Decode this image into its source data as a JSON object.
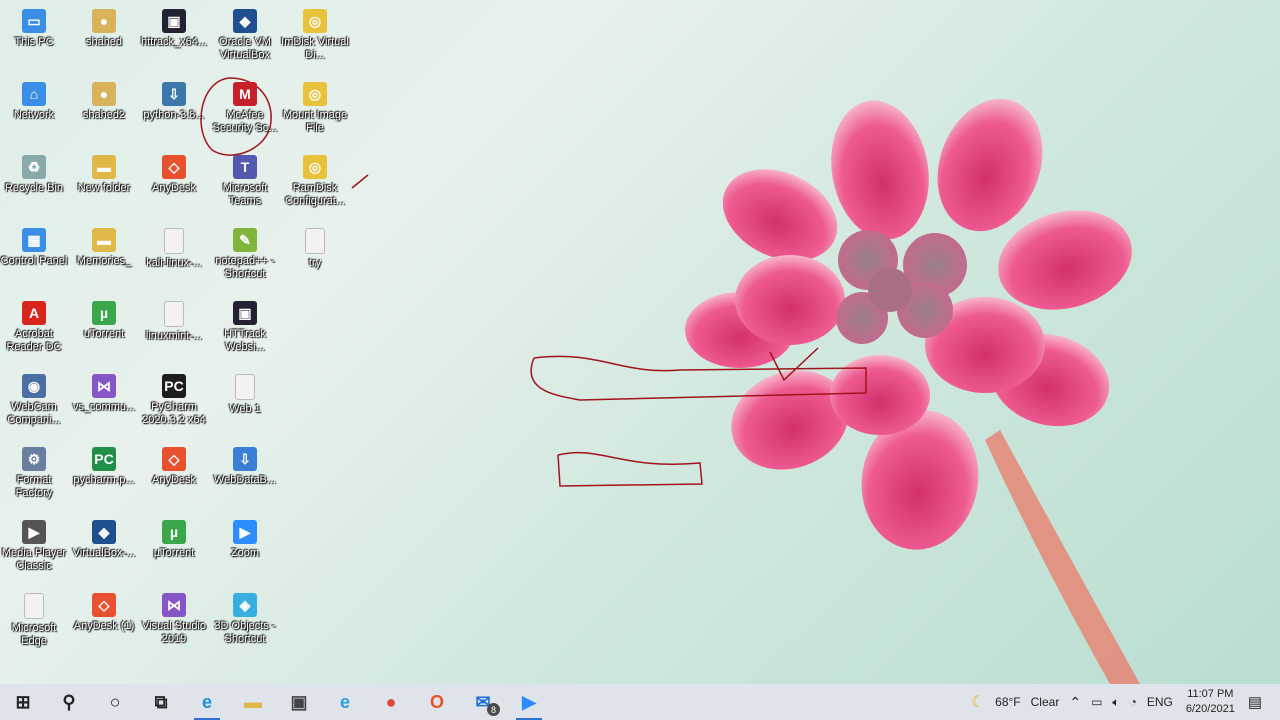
{
  "desktop": {
    "columns": [
      [
        {
          "label": "This PC",
          "icon": "this-pc-icon",
          "color": "#3a8ee6",
          "glyph": "▭"
        },
        {
          "label": "Network",
          "icon": "network-icon",
          "color": "#3a8ee6",
          "glyph": "⌂"
        },
        {
          "label": "Recycle Bin",
          "icon": "recycle-bin-icon",
          "color": "#8aa",
          "glyph": "♻"
        },
        {
          "label": "Control Panel",
          "icon": "control-panel-icon",
          "color": "#3a8ee6",
          "glyph": "▦"
        },
        {
          "label": "Acrobat Reader DC",
          "icon": "acrobat-icon",
          "color": "#d8261d",
          "glyph": "A"
        },
        {
          "label": "WebCam Compani...",
          "icon": "webcam-icon",
          "color": "#4a6fa5",
          "glyph": "◉"
        },
        {
          "label": "Format Factory",
          "icon": "format-factory-icon",
          "color": "#6a7fa0",
          "glyph": "⚙"
        },
        {
          "label": "Media Player Classic",
          "icon": "media-player-icon",
          "color": "#555",
          "glyph": "▶"
        },
        {
          "label": "Microsoft Edge",
          "icon": "file-icon",
          "color": "#f2f2f2",
          "glyph": ""
        }
      ],
      [
        {
          "label": "shahed",
          "icon": "user-folder-icon",
          "color": "#d9b35a",
          "glyph": "●"
        },
        {
          "label": "shahed2",
          "icon": "user-folder-icon",
          "color": "#d9b35a",
          "glyph": "●"
        },
        {
          "label": "New folder",
          "icon": "folder-icon",
          "color": "#e0b84a",
          "glyph": "▬"
        },
        {
          "label": "Memories_",
          "icon": "folder-icon",
          "color": "#e0b84a",
          "glyph": "▬"
        },
        {
          "label": "uTorrent",
          "icon": "utorrent-icon",
          "color": "#3aa84a",
          "glyph": "µ"
        },
        {
          "label": "vs_commu...",
          "icon": "visual-studio-icon",
          "color": "#8655c6",
          "glyph": "⋈"
        },
        {
          "label": "pycharm-p...",
          "icon": "pycharm-icon",
          "color": "#1f8f4a",
          "glyph": "PC"
        },
        {
          "label": "VirtualBox-...",
          "icon": "virtualbox-icon",
          "color": "#1f4f8f",
          "glyph": "◆"
        },
        {
          "label": "AnyDesk (1)",
          "icon": "anydesk-icon",
          "color": "#e8512f",
          "glyph": "◇"
        }
      ],
      [
        {
          "label": "httrack_x64...",
          "icon": "httrack-icon",
          "color": "#223",
          "glyph": "▣"
        },
        {
          "label": "python-3.8...",
          "icon": "python-installer-icon",
          "color": "#3b77a8",
          "glyph": "⇩"
        },
        {
          "label": "AnyDesk",
          "icon": "anydesk-icon",
          "color": "#e8512f",
          "glyph": "◇"
        },
        {
          "label": "kali-linux-...",
          "icon": "file-icon",
          "color": "#f2f2f2",
          "glyph": ""
        },
        {
          "label": "linuxmint-...",
          "icon": "file-icon",
          "color": "#f2f2f2",
          "glyph": ""
        },
        {
          "label": "PyCharm 2020.3.2 x64",
          "icon": "pycharm-icon",
          "color": "#1d1d1d",
          "glyph": "PC"
        },
        {
          "label": "AnyDesk",
          "icon": "anydesk-icon",
          "color": "#e8512f",
          "glyph": "◇"
        },
        {
          "label": "µTorrent",
          "icon": "utorrent-icon",
          "color": "#3aa84a",
          "glyph": "µ"
        },
        {
          "label": "Visual Studio 2019",
          "icon": "visual-studio-icon",
          "color": "#8655c6",
          "glyph": "⋈"
        }
      ],
      [
        {
          "label": "Oracle VM VirtualBox",
          "icon": "virtualbox-icon",
          "color": "#1f4f8f",
          "glyph": "◆"
        },
        {
          "label": "McAfee Security Sc...",
          "icon": "mcafee-icon",
          "color": "#c8202a",
          "glyph": "M"
        },
        {
          "label": "Microsoft Teams",
          "icon": "teams-icon",
          "color": "#5558af",
          "glyph": "T"
        },
        {
          "label": "notepad++ - Shortcut",
          "icon": "notepad-plus-icon",
          "color": "#7fb53a",
          "glyph": "✎"
        },
        {
          "label": "HTTrack Websi...",
          "icon": "httrack-icon",
          "color": "#223",
          "glyph": "▣"
        },
        {
          "label": "Web 1",
          "icon": "file-icon",
          "color": "#f2f2f2",
          "glyph": ""
        },
        {
          "label": "WebDataB...",
          "icon": "webdata-icon",
          "color": "#3a7fd4",
          "glyph": "⇩"
        },
        {
          "label": "Zoom",
          "icon": "zoom-icon",
          "color": "#2d8cff",
          "glyph": "▶"
        },
        {
          "label": "3D Objects - Shortcut",
          "icon": "3d-objects-icon",
          "color": "#3aaee0",
          "glyph": "◈"
        }
      ],
      [
        {
          "label": "ImDisk Virtual Di...",
          "icon": "disk-icon",
          "color": "#e8c23a",
          "glyph": "◎"
        },
        {
          "label": "Mount Image File",
          "icon": "disk-icon",
          "color": "#e8c23a",
          "glyph": "◎"
        },
        {
          "label": "RamDisk Configurat...",
          "icon": "disk-icon",
          "color": "#e8c23a",
          "glyph": "◎"
        },
        {
          "label": "try",
          "icon": "file-icon",
          "color": "#f2f2f2",
          "glyph": ""
        }
      ]
    ]
  },
  "taskbar": {
    "apps": [
      {
        "name": "start-button",
        "glyph": "⊞",
        "color": "#222"
      },
      {
        "name": "search-button",
        "glyph": "⚲",
        "color": "#222"
      },
      {
        "name": "cortana-button",
        "glyph": "○",
        "color": "#222"
      },
      {
        "name": "task-view-button",
        "glyph": "⧉",
        "color": "#222"
      },
      {
        "name": "edge-app",
        "glyph": "e",
        "color": "#1a8fd6",
        "active": true
      },
      {
        "name": "file-explorer-app",
        "glyph": "▬",
        "color": "#e0b84a"
      },
      {
        "name": "store-app",
        "glyph": "▣",
        "color": "#444"
      },
      {
        "name": "ie-app",
        "glyph": "e",
        "color": "#2a9ee0"
      },
      {
        "name": "chrome-app",
        "glyph": "●",
        "color": "#e0483a"
      },
      {
        "name": "office-app",
        "glyph": "O",
        "color": "#e8512f"
      },
      {
        "name": "mail-app",
        "glyph": "✉",
        "color": "#1a6fd6",
        "badge": "8"
      },
      {
        "name": "zoom-app",
        "glyph": "▶",
        "color": "#2d8cff",
        "active": true
      }
    ],
    "weather": {
      "icon": "☾",
      "temp": "68°F",
      "condition": "Clear"
    },
    "tray_language": "ENG",
    "clock": {
      "time": "11:07 PM",
      "date": "6/20/2021"
    }
  }
}
